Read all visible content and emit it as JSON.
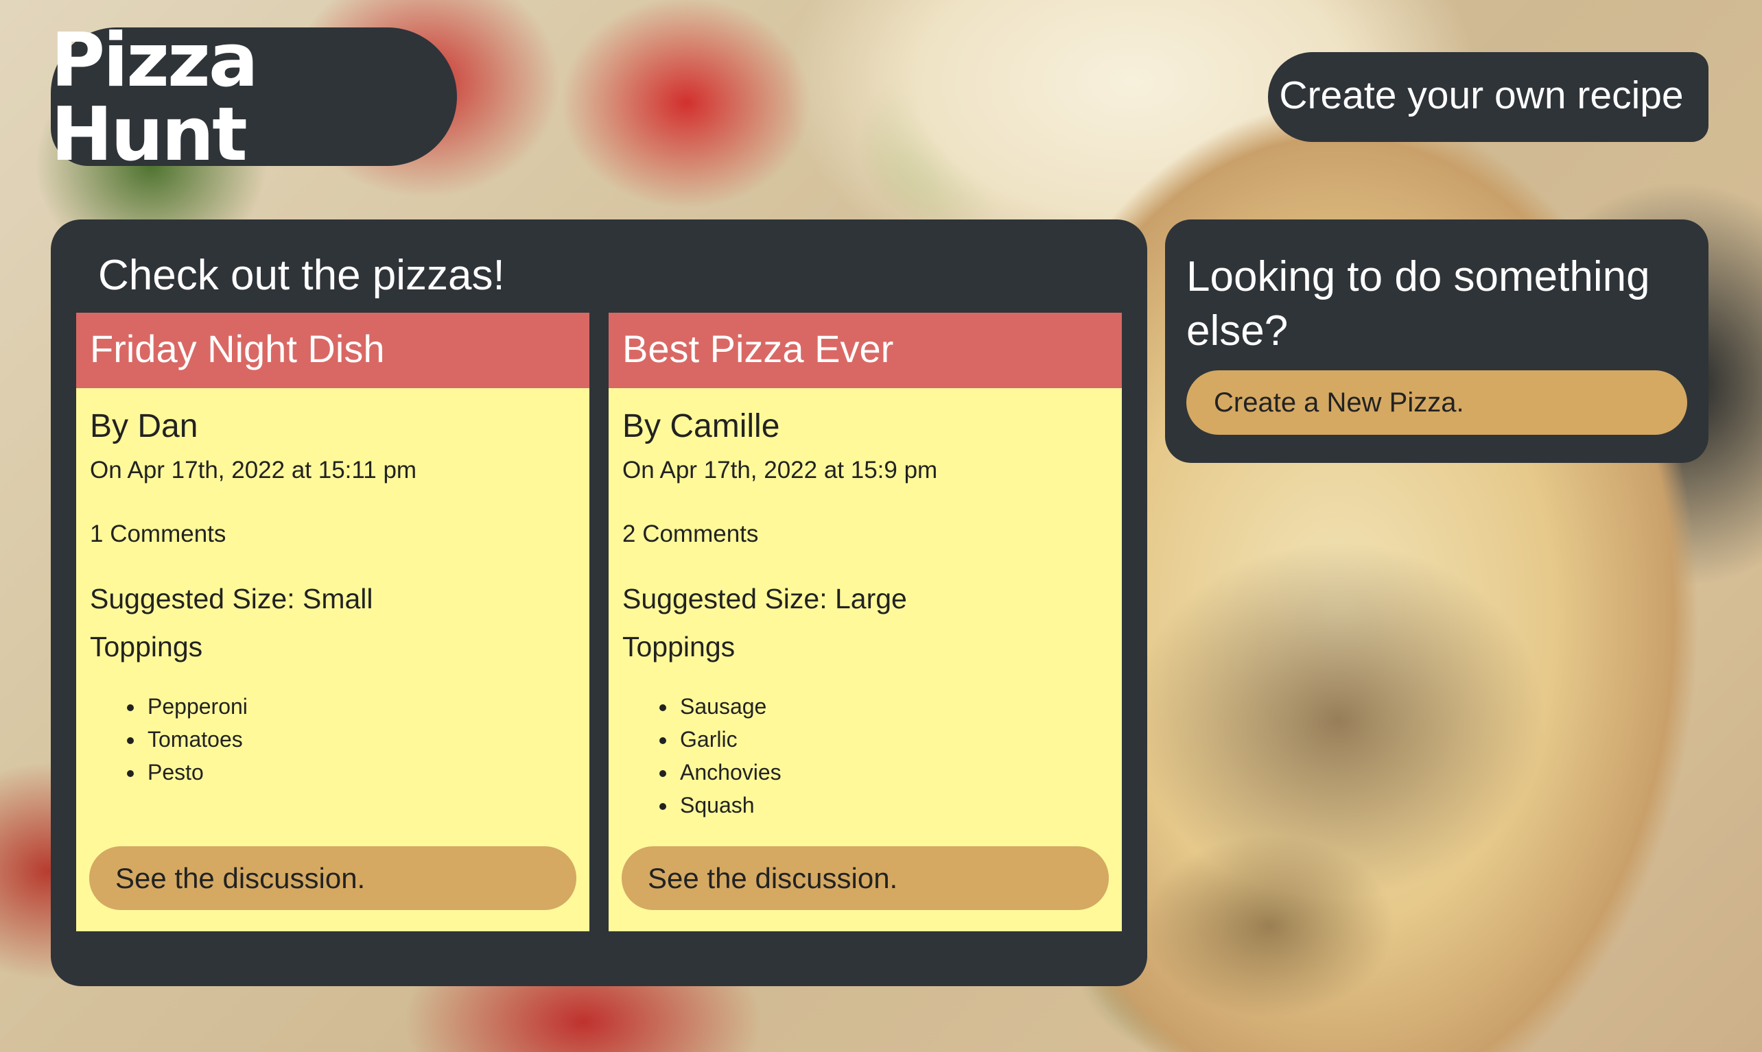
{
  "header": {
    "brand": "Pizza Hunt",
    "nav_link": "Create your own recipe"
  },
  "main": {
    "title": "Check out the pizzas!",
    "pizzas": [
      {
        "name": "Friday Night Dish",
        "author": "By Dan",
        "date": "On Apr 17th, 2022 at 15:11 pm",
        "comments": "1 Comments",
        "size": "Suggested Size: Small",
        "toppings_label": "Toppings",
        "toppings": [
          "Pepperoni",
          "Tomatoes",
          "Pesto"
        ],
        "discussion_label": "See the discussion."
      },
      {
        "name": "Best Pizza Ever",
        "author": "By Camille",
        "date": "On Apr 17th, 2022 at 15:9 pm",
        "comments": "2 Comments",
        "size": "Suggested Size: Large",
        "toppings_label": "Toppings",
        "toppings": [
          "Sausage",
          "Garlic",
          "Anchovies",
          "Squash"
        ],
        "discussion_label": "See the discussion."
      }
    ]
  },
  "sidebar": {
    "title": "Looking to do something else?",
    "button_label": "Create a New Pizza."
  },
  "colors": {
    "panel_bg": "#2f3439",
    "card_header": "#d96864",
    "card_body": "#fff99a",
    "button_bg": "#d5a962",
    "text_light": "#ffffff",
    "text_dark": "#222222"
  }
}
